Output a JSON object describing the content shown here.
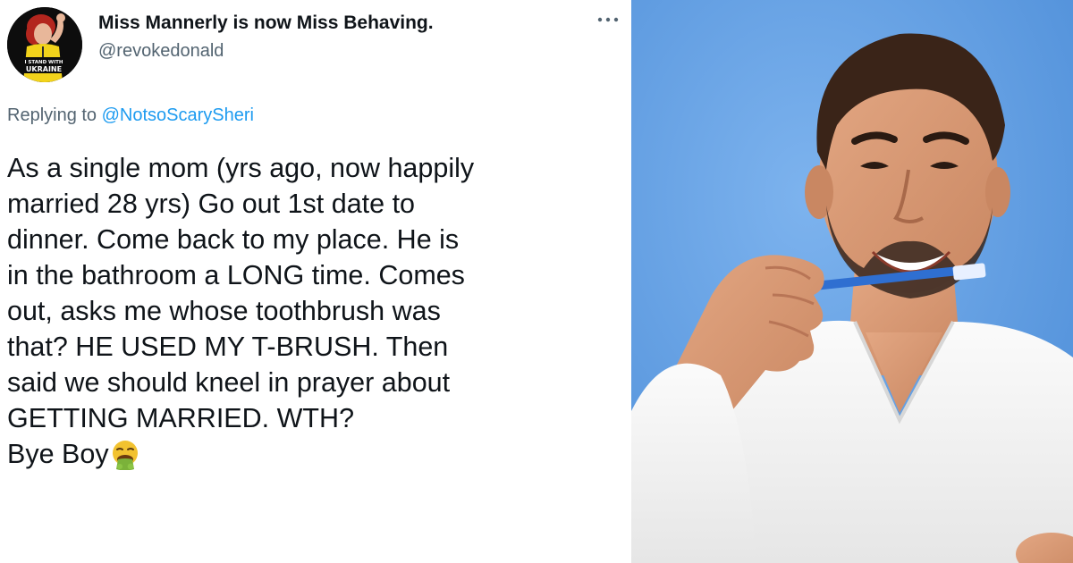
{
  "tweet": {
    "display_name": "Miss Mannerly is now Miss Behaving.",
    "handle": "@revokedonald",
    "avatar_text": [
      "I STAND WITH",
      "UKRAINE"
    ],
    "replying_prefix": "Replying to",
    "replying_to": "@NotsoScarySheri",
    "body_lines": [
      "As a single mom (yrs ago, now happily",
      "married 28 yrs) Go out 1st date to",
      "dinner. Come back to my place. He is",
      "in the bathroom a LONG time. Comes",
      "out, asks me whose toothbrush was",
      "that? HE USED MY T-BRUSH. Then",
      "said we should kneel in prayer about",
      "GETTING MARRIED. WTH?",
      "Bye Boy"
    ],
    "end_emoji": "face-vomiting-emoji"
  },
  "photo": {
    "subject": "man-brushing-teeth-photo",
    "background_color": "#6aa5e6"
  },
  "colors": {
    "name": "#0f1419",
    "secondary": "#536471",
    "link": "#1d9bf0"
  }
}
